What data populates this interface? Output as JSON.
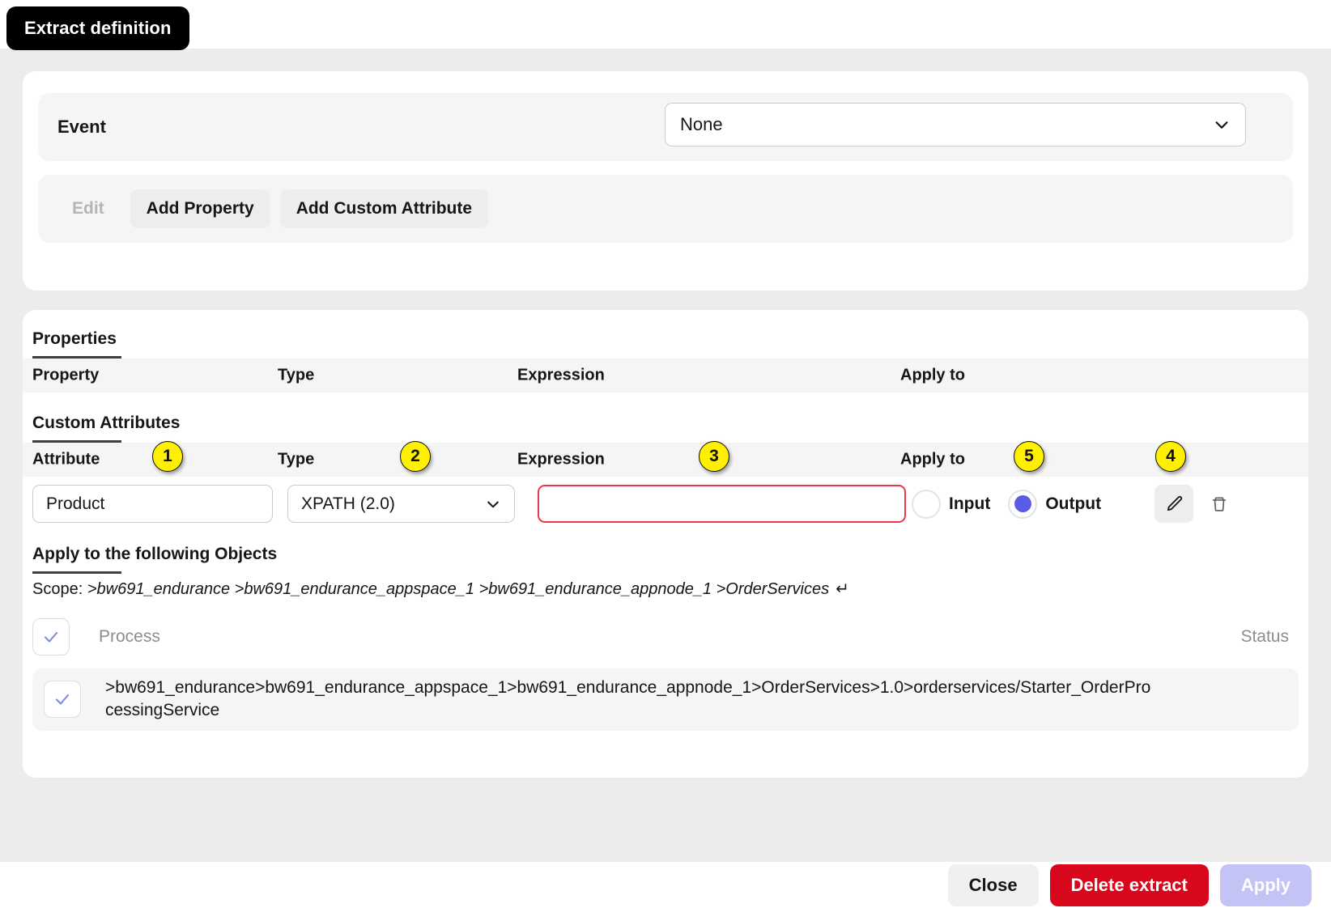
{
  "title_badge": {
    "label": "Extract definition"
  },
  "event_section": {
    "label": "Event",
    "select": {
      "value": "None",
      "icon": "chevron-down-icon"
    }
  },
  "toolbar": {
    "edit_label": "Edit",
    "add_property_label": "Add Property",
    "add_custom_attribute_label": "Add Custom Attribute"
  },
  "properties": {
    "heading": "Properties",
    "columns": {
      "property": "Property",
      "type": "Type",
      "expression": "Expression",
      "apply_to": "Apply to"
    }
  },
  "custom_attributes": {
    "heading": "Custom Attributes",
    "columns": {
      "attribute": "Attribute",
      "type": "Type",
      "expression": "Expression",
      "apply_to": "Apply to"
    },
    "badges": {
      "attribute": "1",
      "type": "2",
      "expression": "3",
      "actions": "4",
      "apply_to": "5"
    },
    "row": {
      "attribute_value": "Product",
      "type_value": "XPATH (2.0)",
      "expression_value": "",
      "expression_placeholder": "",
      "apply_to_input_label": "Input",
      "apply_to_output_label": "Output",
      "apply_to_selected": "Output",
      "edit_icon": "pencil-icon",
      "delete_icon": "trash-icon"
    }
  },
  "apply_objects": {
    "heading": "Apply to the following Objects",
    "scope_prefix": "Scope: ",
    "scope_path": ">bw691_endurance >bw691_endurance_appspace_1 >bw691_endurance_appnode_1 >OrderServices",
    "scope_enter_glyph": "↵",
    "process_column": "Process",
    "status_column": "Status",
    "items": [
      {
        "checked": true,
        "path": ">bw691_endurance>bw691_endurance_appspace_1>bw691_endurance_appnode_1>OrderServices>1.0>orderservices/Starter_OrderProcessingService"
      }
    ]
  },
  "footer": {
    "close_label": "Close",
    "delete_label": "Delete extract",
    "apply_label": "Apply"
  },
  "colors": {
    "badge_yellow": "#FFEF00",
    "error_red": "#E8394A",
    "delete_red": "#D8071B",
    "apply_disabled": "#C3C4F5",
    "radio_blue": "#5A5CE6",
    "check_blue": "#7B8AE0"
  }
}
